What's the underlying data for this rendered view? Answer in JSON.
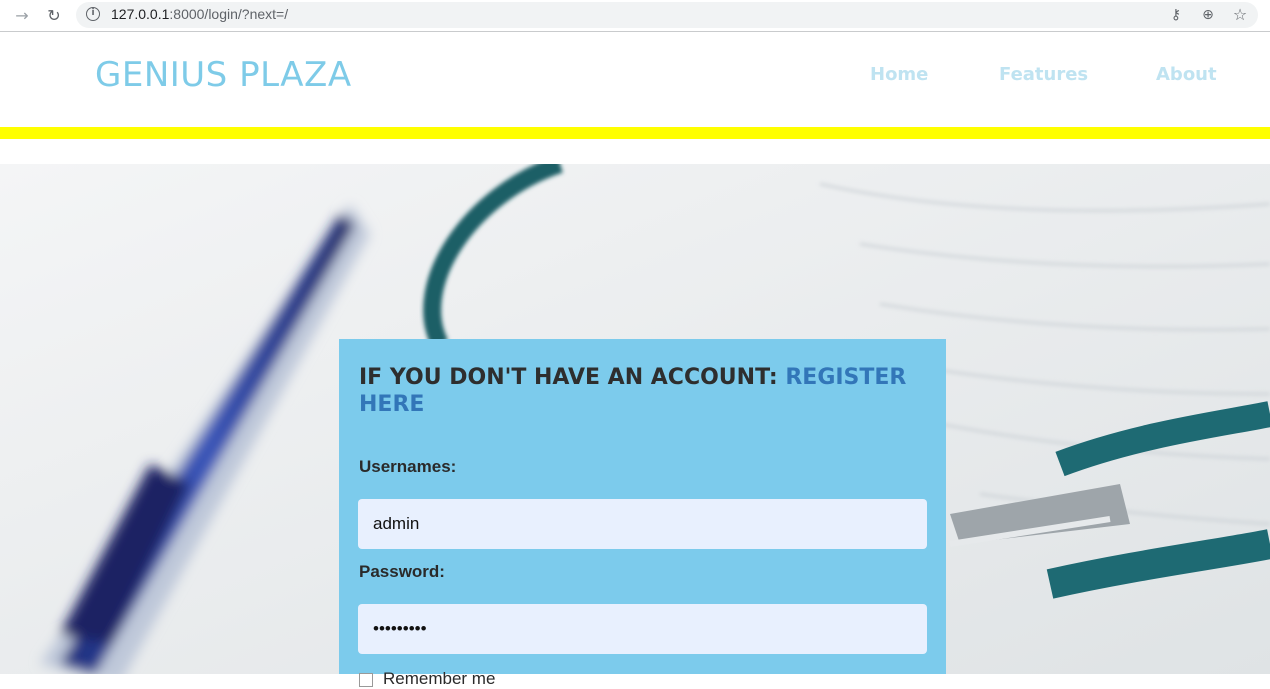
{
  "browser": {
    "url_host": "127.0.0.1",
    "url_rest": ":8000/login/?next=/",
    "icons": [
      "arrow-forward-icon",
      "reload-icon",
      "info-icon",
      "key-icon",
      "zoom-icon",
      "star-icon"
    ]
  },
  "site": {
    "brand": "GENIUS PLAZA",
    "nav": {
      "home": "Home",
      "features": "Features",
      "about": "About"
    },
    "colors": {
      "brand": "#7ecbe8",
      "nav": "#bfe3f1",
      "accent_bar": "#ffff00",
      "panel": "#7ccbec",
      "link": "#3276b8"
    }
  },
  "login": {
    "heading_prefix": "IF YOU DON'T HAVE AN ACCOUNT: ",
    "register_link": "REGISTER HERE",
    "username_label": "Usernames:",
    "username_value": "admin",
    "password_label": "Password:",
    "password_value": "•••••••••",
    "remember_label": "Remember me"
  }
}
